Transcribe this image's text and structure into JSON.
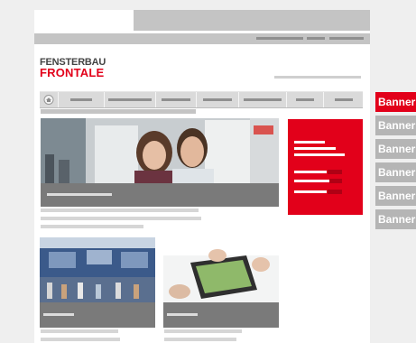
{
  "header": {
    "logo": {
      "line1": "FENSTERBAU",
      "line2": "FRONTALE"
    }
  },
  "navigation": {
    "home_icon": "home-icon",
    "item_count": 7
  },
  "banners": [
    {
      "label": "Banner",
      "active": true
    },
    {
      "label": "Banner",
      "active": false
    },
    {
      "label": "Banner",
      "active": false
    },
    {
      "label": "Banner",
      "active": false
    },
    {
      "label": "Banner",
      "active": false
    },
    {
      "label": "Banner",
      "active": false
    }
  ],
  "colors": {
    "brand_red": "#e2001a",
    "placeholder_gray": "#c4c4c4",
    "caption_gray": "#7a7a7a",
    "page_background": "#efefef"
  }
}
